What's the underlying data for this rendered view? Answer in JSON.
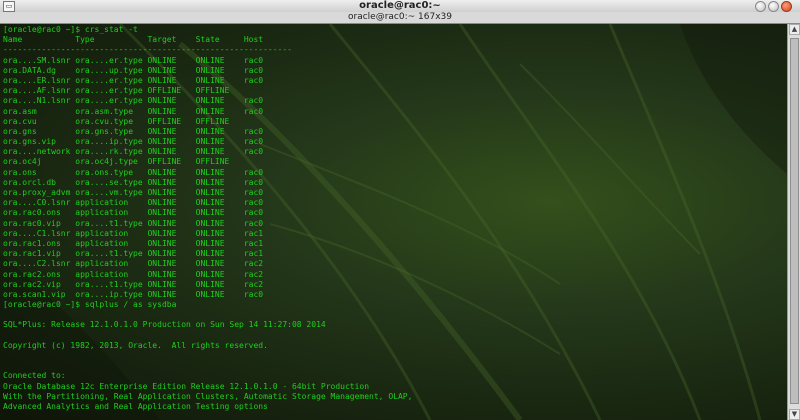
{
  "window": {
    "title": "oracle@rac0:~",
    "subtitle": "oracle@rac0:~ 167x39",
    "menu_icon": "window-menu-icon",
    "buttons": [
      "minimize-icon",
      "maximize-icon",
      "close-icon"
    ]
  },
  "terminal": {
    "lines": [
      "[oracle@rac0 ~]$ crs_stat -t",
      "Name           Type           Target    State     Host",
      "------------------------------------------------------------",
      "ora....SM.lsnr ora....er.type ONLINE    ONLINE    rac0",
      "ora.DATA.dg    ora....up.type ONLINE    ONLINE    rac0",
      "ora....ER.lsnr ora....er.type ONLINE    ONLINE    rac0",
      "ora....AF.lsnr ora....er.type OFFLINE   OFFLINE",
      "ora....N1.lsnr ora....er.type ONLINE    ONLINE    rac0",
      "ora.asm        ora.asm.type   ONLINE    ONLINE    rac0",
      "ora.cvu        ora.cvu.type   OFFLINE   OFFLINE",
      "ora.gns        ora.gns.type   ONLINE    ONLINE    rac0",
      "ora.gns.vip    ora....ip.type ONLINE    ONLINE    rac0",
      "ora....network ora....rk.type ONLINE    ONLINE    rac0",
      "ora.oc4j       ora.oc4j.type  OFFLINE   OFFLINE",
      "ora.ons        ora.ons.type   ONLINE    ONLINE    rac0",
      "ora.orcl.db    ora....se.type ONLINE    ONLINE    rac0",
      "ora.proxy_advm ora....vm.type ONLINE    ONLINE    rac0",
      "ora....C0.lsnr application    ONLINE    ONLINE    rac0",
      "ora.rac0.ons   application    ONLINE    ONLINE    rac0",
      "ora.rac0.vip   ora....t1.type ONLINE    ONLINE    rac0",
      "ora....C1.lsnr application    ONLINE    ONLINE    rac1",
      "ora.rac1.ons   application    ONLINE    ONLINE    rac1",
      "ora.rac1.vip   ora....t1.type ONLINE    ONLINE    rac1",
      "ora....C2.lsnr application    ONLINE    ONLINE    rac2",
      "ora.rac2.ons   application    ONLINE    ONLINE    rac2",
      "ora.rac2.vip   ora....t1.type ONLINE    ONLINE    rac2",
      "ora.scan1.vip  ora....ip.type ONLINE    ONLINE    rac0",
      "[oracle@rac0 ~]$ sqlplus / as sysdba",
      "",
      "SQL*Plus: Release 12.1.0.1.0 Production on Sun Sep 14 11:27:08 2014",
      "",
      "Copyright (c) 1982, 2013, Oracle.  All rights reserved.",
      "",
      "",
      "Connected to:",
      "Oracle Database 12c Enterprise Edition Release 12.1.0.1.0 - 64bit Production",
      "With the Partitioning, Real Application Clusters, Automatic Storage Management, OLAP,",
      "Advanced Analytics and Real Application Testing options",
      ""
    ]
  },
  "scrollbar": {
    "up_icon": "scroll-up-icon",
    "down_icon": "scroll-down-icon"
  },
  "colors": {
    "text": "#1ed01e",
    "background": "#1f2a10"
  }
}
